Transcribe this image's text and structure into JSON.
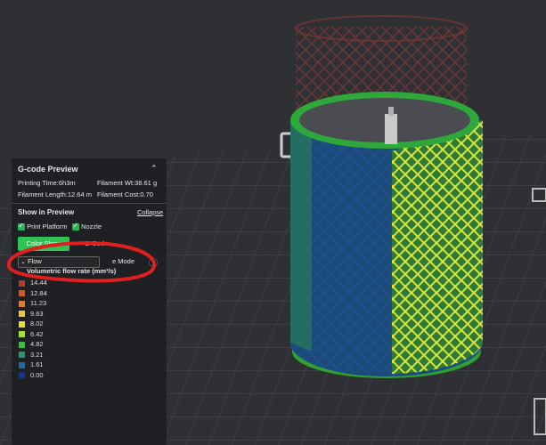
{
  "panel": {
    "title": "G-code Preview",
    "printing_time": "Printing Time:6h3m",
    "filament_weight": "Filament Wt:38.61 g",
    "filament_length": "Filament Length:12.64 m",
    "filament_cost": "Filament Cost:0.70",
    "show_in_preview": "Show in Preview",
    "collapse_label": "Collapse",
    "print_platform_label": "Print Platform",
    "nozzle_label": "Nozzle",
    "tab_color_show": "Color Show",
    "tab_gcode": "G-Code",
    "view_select_value": "Flow",
    "mode_label": "e Mode",
    "legend_title": "Volumetric flow rate (mm³/s)",
    "legend": [
      {
        "value": "14.44",
        "color": "#b03a2e"
      },
      {
        "value": "12.84",
        "color": "#cf5a2c"
      },
      {
        "value": "11.23",
        "color": "#e07b2a"
      },
      {
        "value": "9.63",
        "color": "#f2c62a"
      },
      {
        "value": "8.02",
        "color": "#e4e12a"
      },
      {
        "value": "6.42",
        "color": "#a8e02a"
      },
      {
        "value": "4.82",
        "color": "#34c23a"
      },
      {
        "value": "3.21",
        "color": "#1f9a6e"
      },
      {
        "value": "1.61",
        "color": "#1d6aa3"
      },
      {
        "value": "0.00",
        "color": "#12348f"
      }
    ]
  },
  "colors": {
    "accent_green": "#2fc255",
    "annotation_red": "#e02020"
  },
  "icons": {
    "collapse_arrows": "double-chevron-up-icon",
    "dropdown": "chevron-down-icon"
  }
}
